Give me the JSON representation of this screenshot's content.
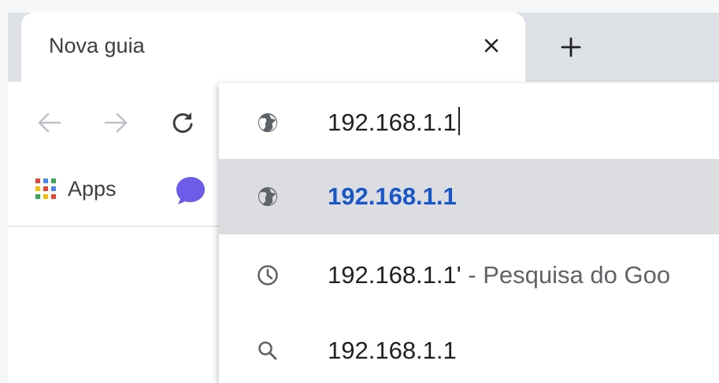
{
  "tab": {
    "title": "Nova guia"
  },
  "toolbar": {
    "back_icon": "arrow-left-icon",
    "forward_icon": "arrow-right-icon",
    "reload_icon": "reload-icon"
  },
  "bookmarks": {
    "apps_label": "Apps"
  },
  "omnibox": {
    "input_value": "192.168.1.1",
    "suggestions": [
      {
        "icon": "globe-icon",
        "text": "192.168.1.1",
        "suffix": ""
      },
      {
        "icon": "history-icon",
        "text": "192.168.1.1'",
        "suffix": " - Pesquisa do Goo"
      },
      {
        "icon": "search-icon",
        "text": "192.168.1.1",
        "suffix": ""
      }
    ]
  },
  "colors": {
    "tabstrip": "#dee1e6",
    "selected_row": "#dcdde1",
    "url_blue": "#1a57c6"
  }
}
